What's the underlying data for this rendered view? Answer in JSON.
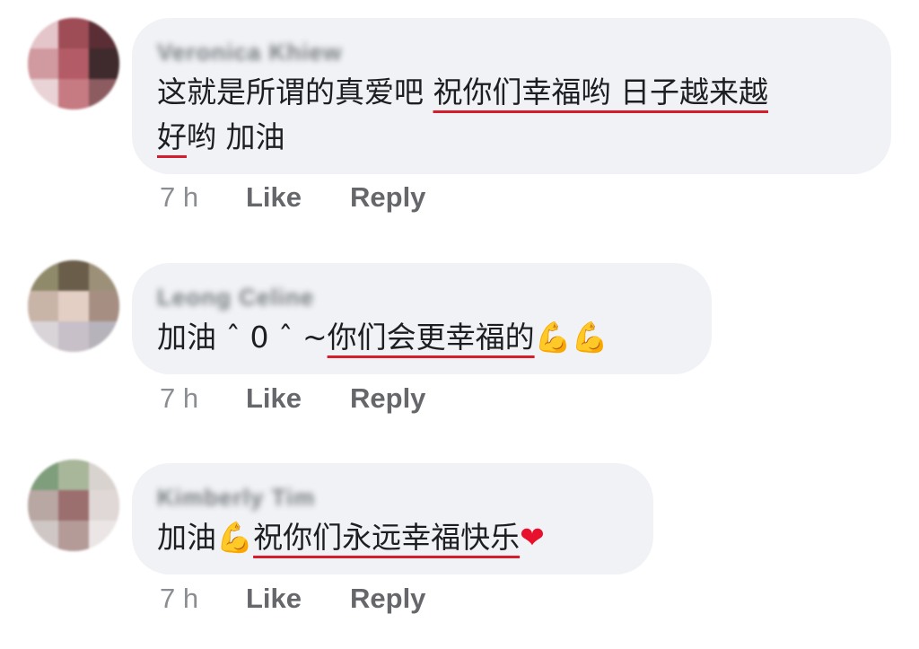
{
  "comments": [
    {
      "author": "Veronica Khiew",
      "text_plain": "这就是所谓的真爱吧 ",
      "text_underlined_1": "祝你们幸福哟 日子越来越",
      "text_underlined_2": "好",
      "text_tail": "哟 加油",
      "time": "7 h",
      "like_label": "Like",
      "reply_label": "Reply"
    },
    {
      "author": "Leong Celine",
      "text_plain": "加油 ˆ 0 ˆ ~",
      "text_underlined": "你们会更幸福的",
      "emoji": "💪💪",
      "time": "7 h",
      "like_label": "Like",
      "reply_label": "Reply"
    },
    {
      "author": "Kimberly Tim",
      "text_plain": "加油",
      "emoji_1": "💪",
      "text_underlined": "祝你们永远幸福快乐",
      "emoji_2": "❤",
      "time": "7 h",
      "like_label": "Like",
      "reply_label": "Reply"
    }
  ],
  "colors": {
    "bubble": "#f0f2f5",
    "text": "#1c1e21",
    "action": "#65676b",
    "underline": "#d61d2b"
  },
  "icons": [
    "flexed-biceps-emoji",
    "red-heart-emoji"
  ]
}
